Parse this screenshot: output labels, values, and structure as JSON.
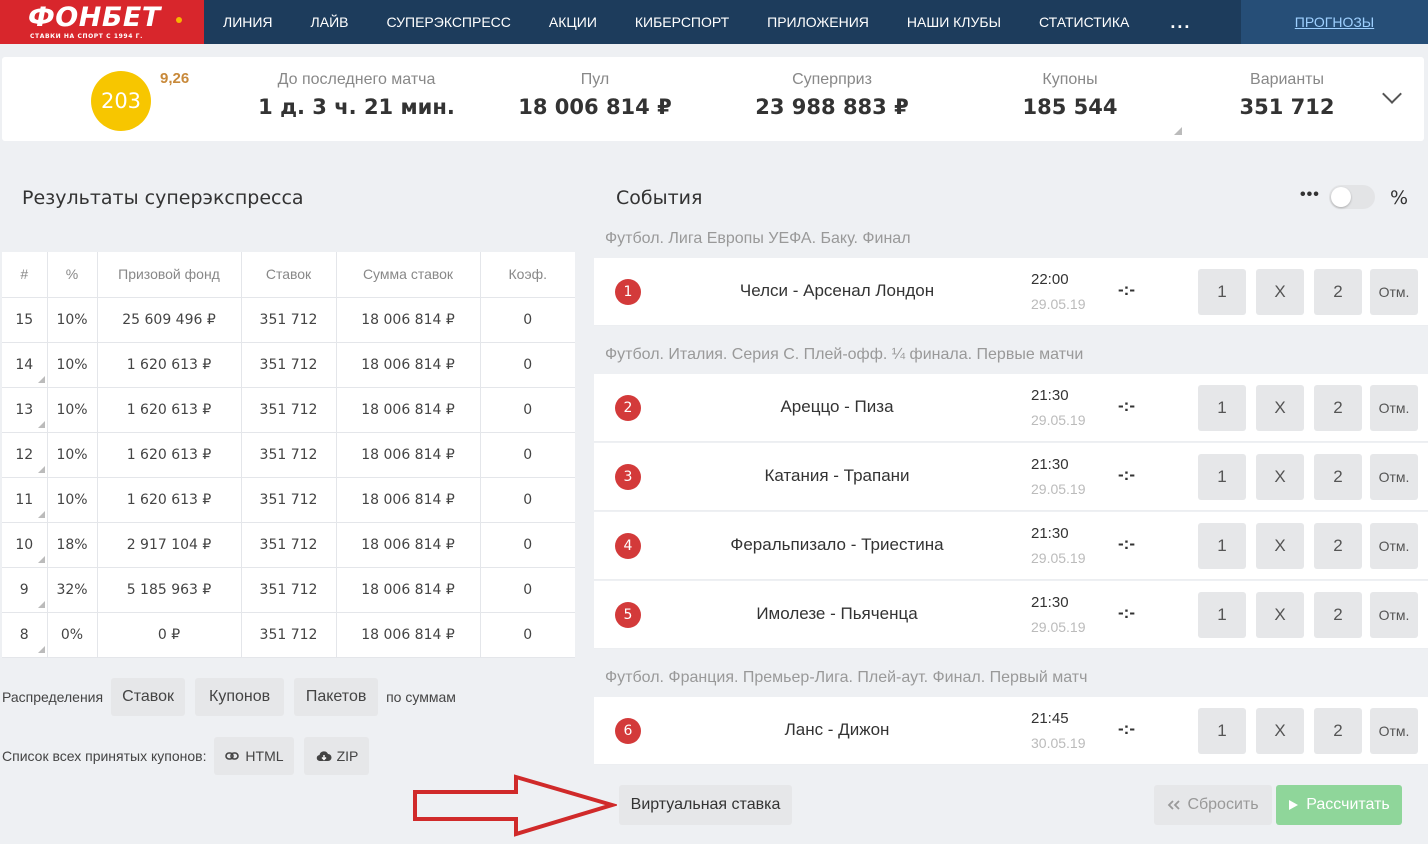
{
  "brand": {
    "logo_text": "ФОНБЕТ",
    "logo_tagline": "СТАВКИ НА СПОРТ С 1994 Г."
  },
  "nav": {
    "items": [
      "ЛИНИЯ",
      "ЛАЙВ",
      "СУПЕРЭКСПРЕСС",
      "АКЦИИ",
      "КИБЕРСПОРТ",
      "ПРИЛОЖЕНИЯ",
      "НАШИ КЛУБЫ",
      "СТАТИСТИКА"
    ],
    "more": "...",
    "forecasts": "ПРОГНОЗЫ"
  },
  "stats": {
    "draw_number": "203",
    "coef": "9,26",
    "until_label": "До последнего матча",
    "until_value": "1 д. 3 ч. 21 мин.",
    "pool_label": "Пул",
    "pool_value": "18 006 814 ₽",
    "superprize_label": "Суперприз",
    "superprize_value": "23 988 883 ₽",
    "coupons_label": "Купоны",
    "coupons_value": "185 544",
    "variants_label": "Варианты",
    "variants_value": "351 712"
  },
  "results": {
    "title": "Результаты суперэкспресса",
    "headers": [
      "#",
      "%",
      "Призовой фонд",
      "Ставок",
      "Сумма ставок",
      "Коэф."
    ],
    "rows": [
      [
        "15",
        "10%",
        "25 609 496 ₽",
        "351 712",
        "18 006 814 ₽",
        "0"
      ],
      [
        "14",
        "10%",
        "1 620 613 ₽",
        "351 712",
        "18 006 814 ₽",
        "0"
      ],
      [
        "13",
        "10%",
        "1 620 613 ₽",
        "351 712",
        "18 006 814 ₽",
        "0"
      ],
      [
        "12",
        "10%",
        "1 620 613 ₽",
        "351 712",
        "18 006 814 ₽",
        "0"
      ],
      [
        "11",
        "10%",
        "1 620 613 ₽",
        "351 712",
        "18 006 814 ₽",
        "0"
      ],
      [
        "10",
        "18%",
        "2 917 104 ₽",
        "351 712",
        "18 006 814 ₽",
        "0"
      ],
      [
        "9",
        "32%",
        "5 185 963 ₽",
        "351 712",
        "18 006 814 ₽",
        "0"
      ],
      [
        "8",
        "0%",
        "0 ₽",
        "351 712",
        "18 006 814 ₽",
        "0"
      ]
    ]
  },
  "distribution": {
    "label": "Распределения",
    "bets": "Ставок",
    "coupons": "Купонов",
    "packages": "Пакетов",
    "suffix": "по суммам"
  },
  "coupon_list": {
    "label": "Список всех принятых купонов:",
    "html": "HTML",
    "zip": "ZIP"
  },
  "events": {
    "title": "События",
    "more": "•••",
    "percent": "%",
    "leagues": [
      "Футбол. Лига Европы УЕФА. Баку. Финал",
      "Футбол. Италия. Серия С. Плей-офф. ¼ финала. Первые матчи",
      "Футбол. Франция. Премьер-Лига. Плей-аут. Финал. Первый матч"
    ],
    "list": [
      {
        "num": "1",
        "name": "Челси - Арсенал Лондон",
        "time": "22:00",
        "date": "29.05.19",
        "score": "-:-"
      },
      {
        "num": "2",
        "name": "Ареццо - Пиза",
        "time": "21:30",
        "date": "29.05.19",
        "score": "-:-"
      },
      {
        "num": "3",
        "name": "Катания - Трапани",
        "time": "21:30",
        "date": "29.05.19",
        "score": "-:-"
      },
      {
        "num": "4",
        "name": "Феральпизало - Триестина",
        "time": "21:30",
        "date": "29.05.19",
        "score": "-:-"
      },
      {
        "num": "5",
        "name": "Имолезе - Пьяченца",
        "time": "21:30",
        "date": "29.05.19",
        "score": "-:-"
      },
      {
        "num": "6",
        "name": "Ланс - Дижон",
        "time": "21:45",
        "date": "30.05.19",
        "score": "-:-"
      }
    ],
    "outcomes": [
      "1",
      "X",
      "2",
      "Отм."
    ]
  },
  "actions": {
    "virtual_bet": "Виртуальная ставка",
    "reset": "Сбросить",
    "calculate": "Рассчитать"
  },
  "colors": {
    "nav_bg": "#1d3c5c",
    "logo_red": "#d8262c",
    "ball_yellow": "#f7c600",
    "event_red": "#d33a3a",
    "calc_green": "#8fd69a",
    "arrow_red": "#d02a2a"
  }
}
